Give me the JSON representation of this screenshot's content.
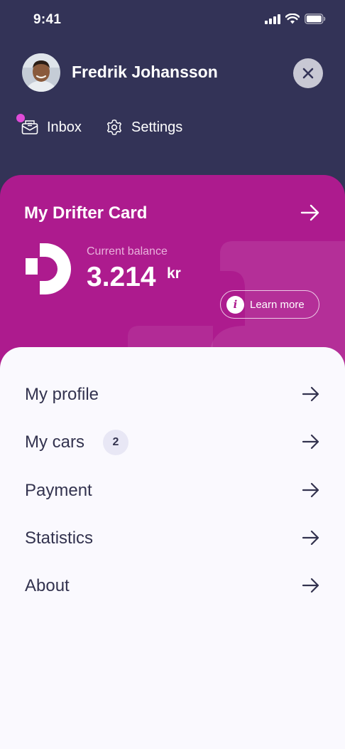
{
  "status_bar": {
    "time": "9:41"
  },
  "header": {
    "user_name": "Fredrik Johansson",
    "nav": [
      {
        "label": "Inbox",
        "icon": "mail-icon",
        "has_notification": true
      },
      {
        "label": "Settings",
        "icon": "gear-icon"
      }
    ]
  },
  "card": {
    "title": "My Drifter Card",
    "balance_label": "Current balance",
    "balance_amount": "3.214",
    "balance_currency": "kr",
    "learn_more_label": "Learn more",
    "info_icon": "i"
  },
  "menu": {
    "items": [
      {
        "label": "My profile"
      },
      {
        "label": "My cars",
        "badge": "2"
      },
      {
        "label": "Payment"
      },
      {
        "label": "Statistics"
      },
      {
        "label": "About"
      }
    ]
  },
  "colors": {
    "header_bg": "#333357",
    "card_bg": "#ad1b8e",
    "sheet_bg": "#faf9fe",
    "text_dark": "#33334f",
    "notification_dot": "#e04bd8"
  }
}
